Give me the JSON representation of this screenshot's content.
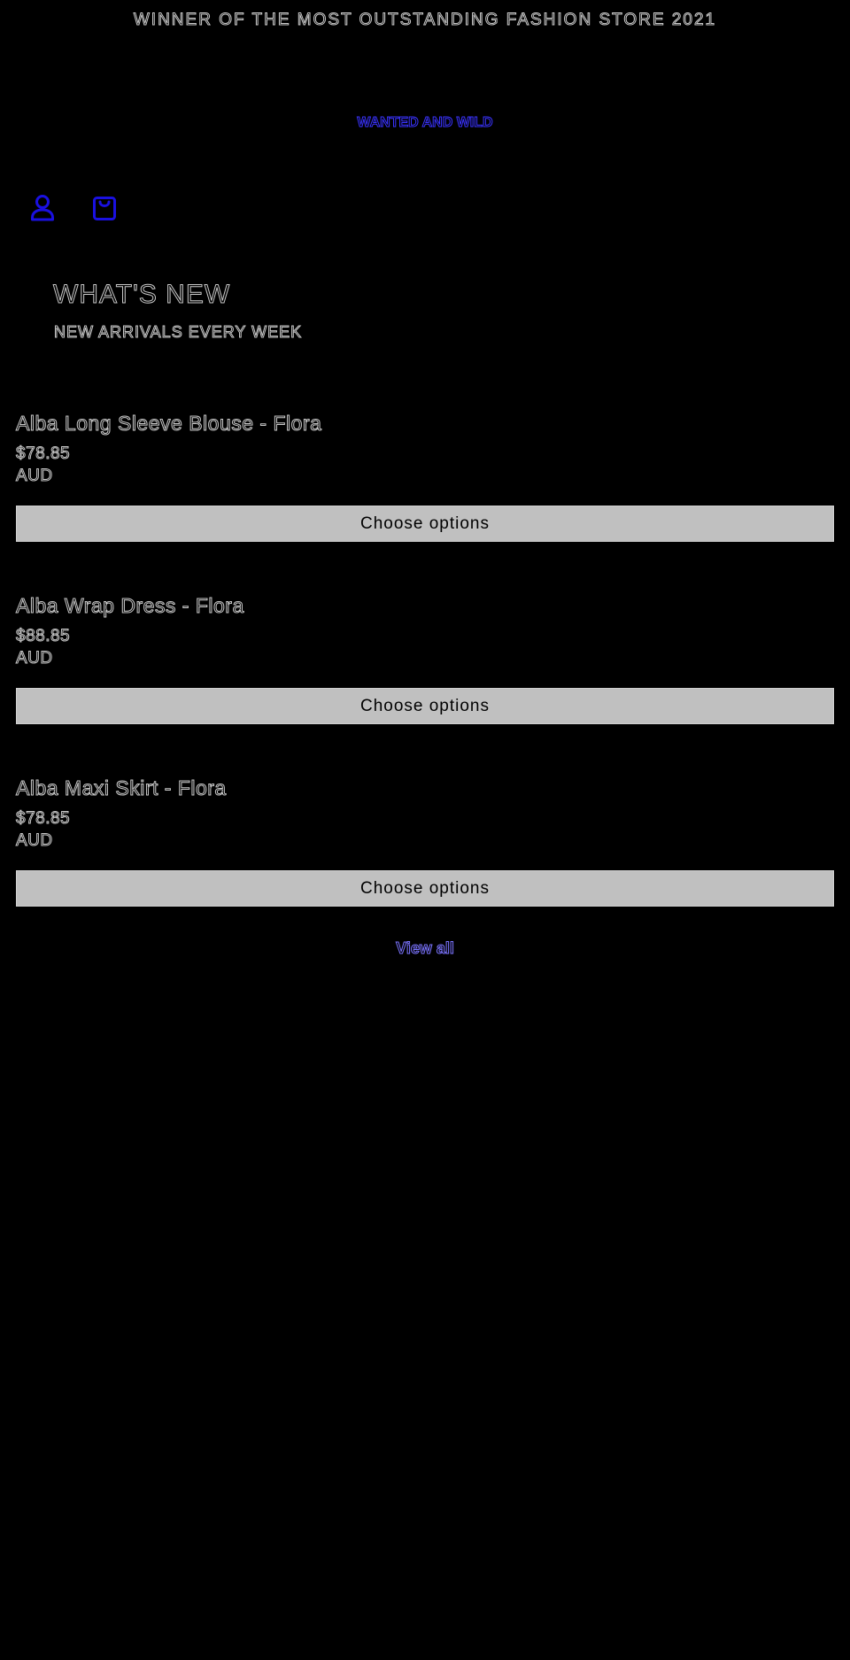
{
  "announcement": {
    "text": "WINNER OF THE MOST OUTSTANDING FASHION STORE 2021"
  },
  "header": {
    "brand": "WANTED AND WILD",
    "icons": {
      "account": "account-icon",
      "cart": "cart-icon"
    }
  },
  "section": {
    "title": "WHAT'S NEW",
    "subtitle": "NEW ARRIVALS EVERY WEEK"
  },
  "products": [
    {
      "name": "Alba Long Sleeve Blouse - Flora",
      "price": "$78.85",
      "currency": "AUD",
      "button_label": "Choose options"
    },
    {
      "name": "Alba Wrap Dress - Flora",
      "price": "$88.85",
      "currency": "AUD",
      "button_label": "Choose options"
    },
    {
      "name": "Alba Maxi Skirt - Flora",
      "price": "$78.85",
      "currency": "AUD",
      "button_label": "Choose options"
    }
  ],
  "view_all": {
    "label": "View all"
  },
  "colors": {
    "background": "#000000",
    "outline_text": "#c8c8c8",
    "brand_link": "#3a33ff",
    "view_all_link": "#7b74ff",
    "icon_stroke": "#1a10e0",
    "button_fill": "#c0c0c0"
  }
}
